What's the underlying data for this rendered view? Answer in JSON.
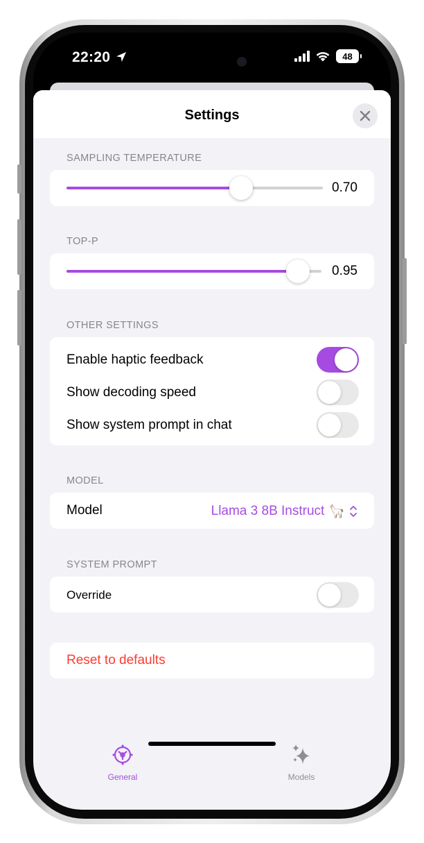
{
  "status_bar": {
    "time": "22:20",
    "battery": "48"
  },
  "sheet": {
    "title": "Settings"
  },
  "sampling": {
    "label": "SAMPLING TEMPERATURE",
    "value_text": "0.70",
    "fraction": 0.7
  },
  "top_p": {
    "label": "TOP-P",
    "value_text": "0.95",
    "fraction": 0.95
  },
  "other": {
    "label": "OTHER SETTINGS",
    "items": [
      {
        "label": "Enable haptic feedback",
        "on": true
      },
      {
        "label": "Show decoding speed",
        "on": false
      },
      {
        "label": "Show system prompt in chat",
        "on": false
      }
    ]
  },
  "model": {
    "section_label": "MODEL",
    "row_label": "Model",
    "value": "Llama 3 8B Instruct",
    "emoji": "🦙"
  },
  "system_prompt": {
    "section_label": "SYSTEM PROMPT",
    "override_label": "Override",
    "override_on": false
  },
  "reset": {
    "label": "Reset to defaults"
  },
  "tabs": [
    {
      "label": "General",
      "icon": "general-gear-icon",
      "active": true
    },
    {
      "label": "Models",
      "icon": "sparkles-icon",
      "active": false
    }
  ],
  "colors": {
    "accent": "#a64be1",
    "destructive": "#ff3b30",
    "inactive": "#8e8e93"
  }
}
